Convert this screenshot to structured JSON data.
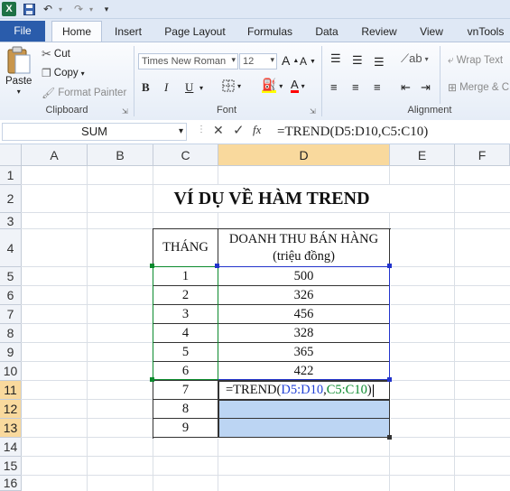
{
  "quick_access": {
    "undo_icon": "↶",
    "redo_icon": "↷",
    "save_icon": "▪"
  },
  "tabs": [
    "File",
    "Home",
    "Insert",
    "Page Layout",
    "Formulas",
    "Data",
    "Review",
    "View",
    "vnTools"
  ],
  "ribbon": {
    "clipboard": {
      "paste": "Paste",
      "cut": "Cut",
      "copy": "Copy",
      "format_painter": "Format Painter",
      "label": "Clipboard"
    },
    "font": {
      "name": "Times New Roman",
      "size": "12",
      "label": "Font",
      "bold": "B",
      "italic": "I",
      "underline": "U"
    },
    "alignment": {
      "wrap": "Wrap Text",
      "merge": "Merge & C",
      "label": "Alignment"
    }
  },
  "formula_bar": {
    "name_box": "SUM",
    "fx": "fx",
    "formula": "=TREND(D5:D10,C5:C10)"
  },
  "columns": [
    "A",
    "B",
    "C",
    "D",
    "E",
    "F"
  ],
  "rows": [
    "1",
    "2",
    "3",
    "4",
    "5",
    "6",
    "7",
    "8",
    "9",
    "10",
    "11",
    "12",
    "13",
    "14",
    "15",
    "16"
  ],
  "sheet": {
    "title": "VÍ DỤ VỀ HÀM TREND",
    "header_c": "THÁNG",
    "header_d_line1": "DOANH THU BÁN HÀNG",
    "header_d_line2": "(triệu đồng)",
    "months": [
      "1",
      "2",
      "3",
      "4",
      "5",
      "6",
      "7",
      "8",
      "9"
    ],
    "revenue": [
      "500",
      "326",
      "456",
      "328",
      "365",
      "422"
    ],
    "edit": {
      "prefix": "=TREND(",
      "range1": "D5:D10",
      "comma": ",",
      "range2": "C5:C10",
      "suffix": ")"
    }
  }
}
